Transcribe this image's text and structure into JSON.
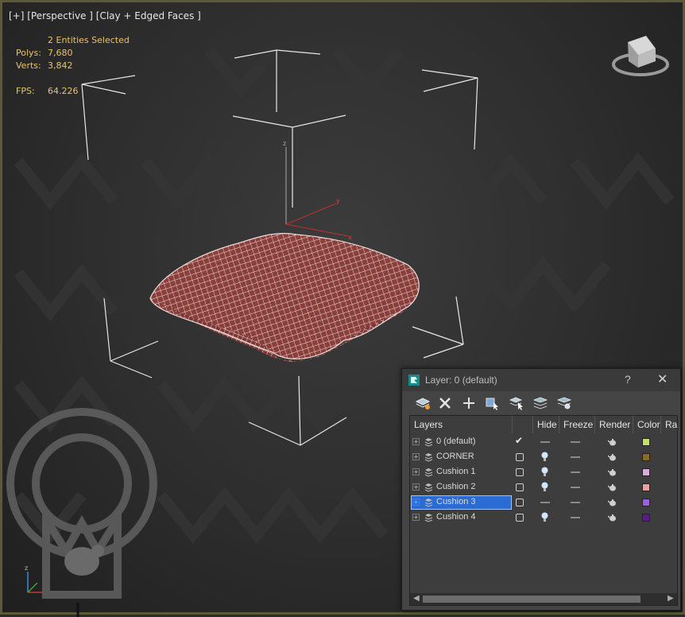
{
  "viewport": {
    "label_plus": "[+]",
    "label_view": "[Perspective ]",
    "label_shading": "[Clay + Edged Faces ]",
    "selection": "2 Entities Selected",
    "polys_label": "Polys:",
    "polys_value": "7,680",
    "verts_label": "Verts:",
    "verts_value": "3,842",
    "fps_label": "FPS:",
    "fps_value": "64.226",
    "axis_z": "z",
    "axis_x": "x",
    "axis_y": "y",
    "gizmo_z": "z"
  },
  "layer_dialog": {
    "title": "Layer: 0 (default)",
    "help": "?",
    "close": "✕",
    "columns": {
      "layers": "Layers",
      "hide": "Hide",
      "freeze": "Freeze",
      "render": "Render",
      "color": "Color",
      "radiosity": "Ra"
    },
    "rows": [
      {
        "name": "0 (default)",
        "current": true,
        "hidden": true,
        "color": "#c3e06a"
      },
      {
        "name": "CORNER",
        "current": false,
        "hidden": false,
        "color": "#8a6a24"
      },
      {
        "name": "Cushion 1",
        "current": false,
        "hidden": false,
        "color": "#e0a8e0"
      },
      {
        "name": "Cushion 2",
        "current": false,
        "hidden": false,
        "color": "#e8a0a0"
      },
      {
        "name": "Cushion 3",
        "current": false,
        "hidden": true,
        "color": "#9b5fe0",
        "selected": true
      },
      {
        "name": "Cushion 4",
        "current": false,
        "hidden": false,
        "color": "#5a1a8a"
      }
    ]
  }
}
